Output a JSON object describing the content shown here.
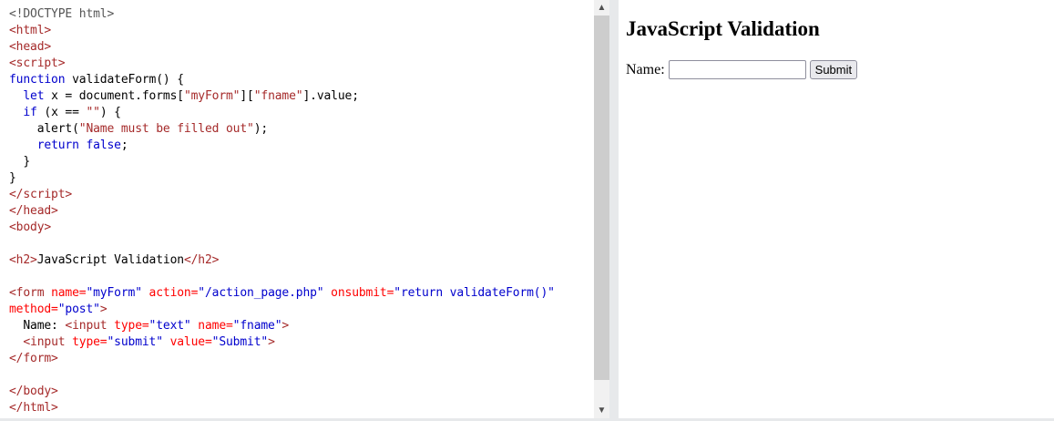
{
  "editor": {
    "lines": [
      [
        [
          "doc",
          "<!DOCTYPE html>"
        ]
      ],
      [
        [
          "tag",
          "<html>"
        ]
      ],
      [
        [
          "tag",
          "<head>"
        ]
      ],
      [
        [
          "tag",
          "<script>"
        ]
      ],
      [
        [
          "kw",
          "function"
        ],
        [
          "txt",
          " validateForm() {"
        ]
      ],
      [
        [
          "txt",
          "  "
        ],
        [
          "kw",
          "let"
        ],
        [
          "txt",
          " x = document.forms["
        ],
        [
          "str",
          "\"myForm\""
        ],
        [
          "txt",
          "]["
        ],
        [
          "str",
          "\"fname\""
        ],
        [
          "txt",
          "].value;"
        ]
      ],
      [
        [
          "txt",
          "  "
        ],
        [
          "kw",
          "if"
        ],
        [
          "txt",
          " (x == "
        ],
        [
          "str",
          "\"\""
        ],
        [
          "txt",
          ") {"
        ]
      ],
      [
        [
          "txt",
          "    alert("
        ],
        [
          "str",
          "\"Name must be filled out\""
        ],
        [
          "txt",
          ");"
        ]
      ],
      [
        [
          "txt",
          "    "
        ],
        [
          "kw",
          "return"
        ],
        [
          "txt",
          " "
        ],
        [
          "kw",
          "false"
        ],
        [
          "txt",
          ";"
        ]
      ],
      [
        [
          "txt",
          "  }"
        ]
      ],
      [
        [
          "txt",
          "}"
        ]
      ],
      [
        [
          "tag",
          "</script>"
        ]
      ],
      [
        [
          "tag",
          "</head>"
        ]
      ],
      [
        [
          "tag",
          "<body>"
        ]
      ],
      [],
      [
        [
          "tag",
          "<h2>"
        ],
        [
          "txt",
          "JavaScript Validation"
        ],
        [
          "tag",
          "</h2>"
        ]
      ],
      [],
      [
        [
          "tag",
          "<form"
        ],
        [
          "attr",
          " name="
        ],
        [
          "val",
          "\"myForm\""
        ],
        [
          "attr",
          " action="
        ],
        [
          "val",
          "\"/action_page.php\""
        ],
        [
          "attr",
          " onsubmit="
        ],
        [
          "val",
          "\"return validateForm()\""
        ]
      ],
      [
        [
          "attr",
          "method="
        ],
        [
          "val",
          "\"post\""
        ],
        [
          "tag",
          ">"
        ]
      ],
      [
        [
          "txt",
          "  Name: "
        ],
        [
          "tag",
          "<input"
        ],
        [
          "attr",
          " type="
        ],
        [
          "val",
          "\"text\""
        ],
        [
          "attr",
          " name="
        ],
        [
          "val",
          "\"fname\""
        ],
        [
          "tag",
          ">"
        ]
      ],
      [
        [
          "txt",
          "  "
        ],
        [
          "tag",
          "<input"
        ],
        [
          "attr",
          " type="
        ],
        [
          "val",
          "\"submit\""
        ],
        [
          "attr",
          " value="
        ],
        [
          "val",
          "\"Submit\""
        ],
        [
          "tag",
          ">"
        ]
      ],
      [
        [
          "tag",
          "</form>"
        ]
      ],
      [],
      [
        [
          "tag",
          "</body>"
        ]
      ],
      [
        [
          "tag",
          "</html>"
        ]
      ]
    ],
    "scroll_up_icon": "chevron-up-icon",
    "scroll_down_icon": "chevron-down-icon"
  },
  "result": {
    "heading": "JavaScript Validation",
    "name_label": "Name:",
    "name_value": "",
    "submit_label": "Submit"
  }
}
